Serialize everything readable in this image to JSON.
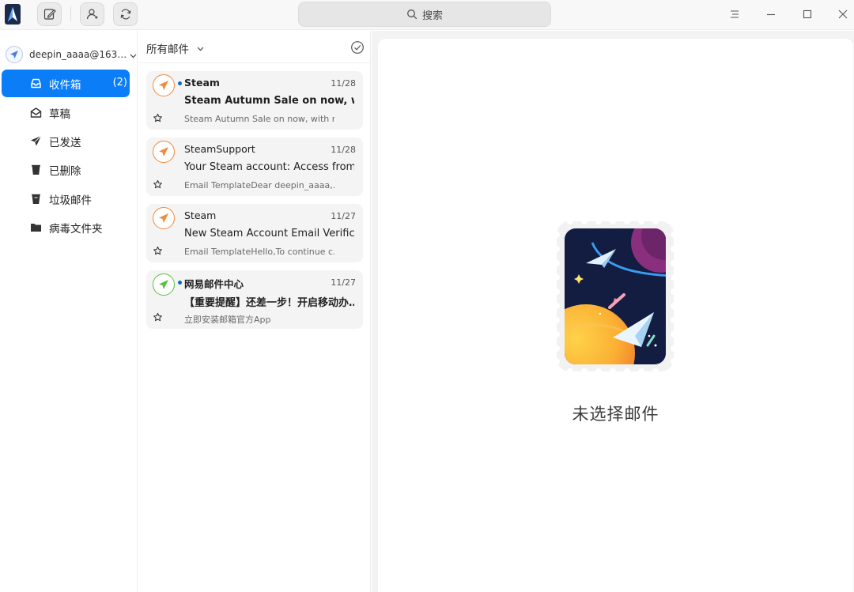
{
  "titlebar": {
    "logo": "deepin-mail-logo",
    "compose_icon": "compose-icon",
    "contacts_icon": "contacts-icon",
    "refresh_icon": "refresh-icon",
    "search_placeholder": "搜索",
    "menu_icon": "menu-icon",
    "minimize_icon": "minimize-icon",
    "maximize_icon": "maximize-icon",
    "close_icon": "close-icon"
  },
  "sidebar": {
    "account": "deepin_aaaa@163…",
    "items": [
      {
        "label": "收件箱",
        "icon": "inbox-icon",
        "count": "(2)",
        "active": true
      },
      {
        "label": "草稿",
        "icon": "drafts-icon",
        "count": "",
        "active": false
      },
      {
        "label": "已发送",
        "icon": "sent-icon",
        "count": "",
        "active": false
      },
      {
        "label": "已删除",
        "icon": "trash-icon",
        "count": "",
        "active": false
      },
      {
        "label": "垃圾邮件",
        "icon": "spam-icon",
        "count": "",
        "active": false
      },
      {
        "label": "病毒文件夹",
        "icon": "folder-icon",
        "count": "",
        "active": false
      }
    ]
  },
  "list": {
    "filter_label": "所有邮件",
    "mails": [
      {
        "sender": "Steam",
        "date": "11/28",
        "subject": "Steam Autumn Sale on now, wit…",
        "preview": "Steam Autumn Sale on now, with r…",
        "unread": true,
        "avatar_color": "#f08a3c"
      },
      {
        "sender": "SteamSupport",
        "date": "11/28",
        "subject": "Your Steam account: Access from …",
        "preview": "Email TemplateDear deepin_aaaa,…",
        "unread": false,
        "avatar_color": "#f08a3c"
      },
      {
        "sender": "Steam",
        "date": "11/27",
        "subject": "New Steam Account Email Verifica…",
        "preview": "Email TemplateHello,To continue c…",
        "unread": false,
        "avatar_color": "#f08a3c"
      },
      {
        "sender": "网易邮件中心",
        "date": "11/27",
        "subject": "【重要提醒】还差一步！开启移动办…",
        "preview": "立即安装邮箱官方App",
        "unread": true,
        "avatar_color": "#5cbf3f"
      }
    ]
  },
  "reader": {
    "empty_text": "未选择邮件",
    "illustration": "space-stamp-illustration"
  },
  "colors": {
    "accent": "#0b7ef7",
    "unread_dot": "#0b66d6"
  }
}
